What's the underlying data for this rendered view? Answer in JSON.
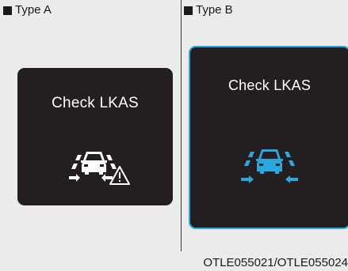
{
  "panel_a": {
    "label": "Type A",
    "screen_text": "Check LKAS",
    "icon": "lkas-car-lanes-warning-icon",
    "icon_color": "#ffffff"
  },
  "panel_b": {
    "label": "Type B",
    "screen_text": "Check LKAS",
    "icon": "lkas-car-lanes-icon",
    "icon_color": "#29a8e0",
    "border_color": "#29a8e0"
  },
  "caption": "OTLE055021/OTLE055024"
}
